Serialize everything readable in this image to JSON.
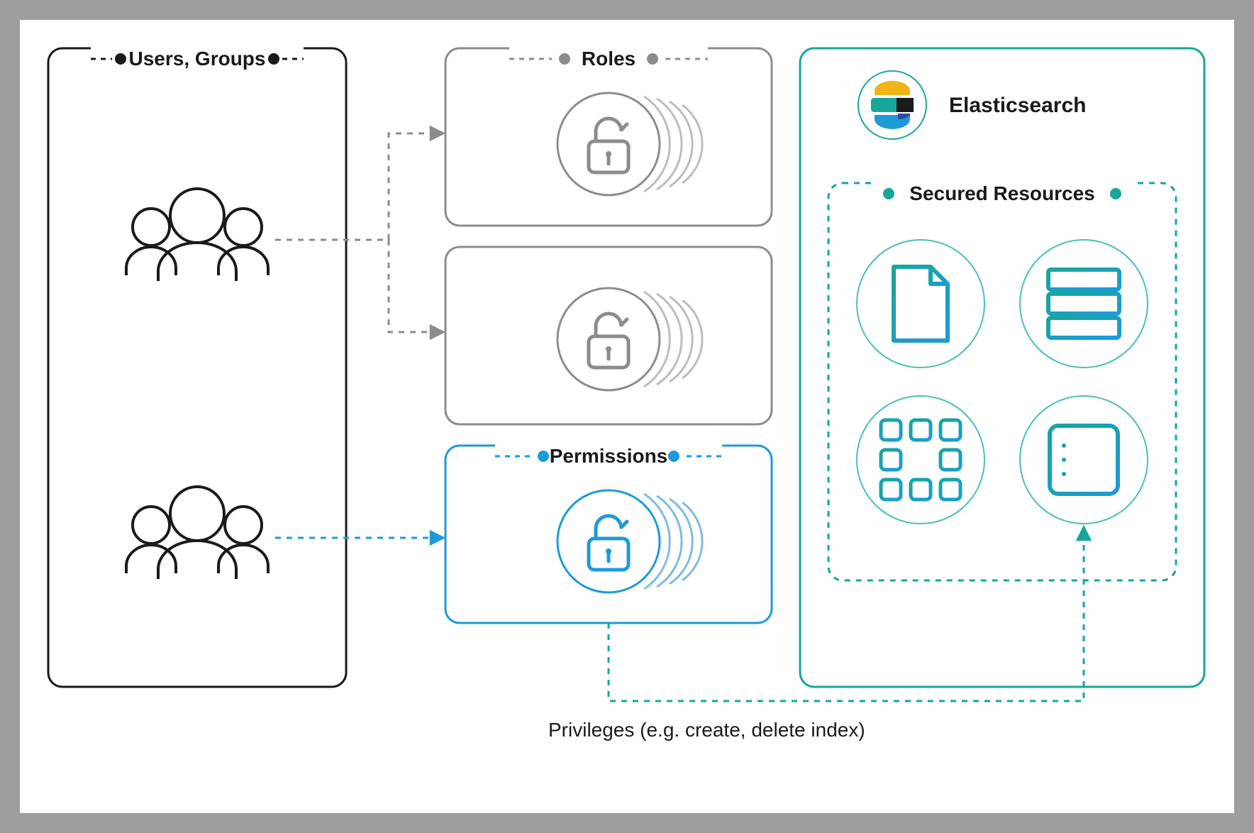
{
  "labels": {
    "users_groups": "Users, Groups",
    "roles": "Roles",
    "permissions": "Permissions",
    "elasticsearch": "Elasticsearch",
    "secured_resources": "Secured Resources",
    "privileges": "Privileges (e.g. create, delete index)"
  },
  "colors": {
    "black": "#1a1a1a",
    "gray": "#8c8c8c",
    "grayLight": "#bdbdbd",
    "blue": "#1c9bd8",
    "bluePale": "#7fbce0",
    "teal": "#17a69b",
    "tealLight": "#4bc0b8",
    "navy": "#2f4b9e",
    "yellow": "#efb514",
    "white": "#ffffff",
    "frame": "#9e9e9e"
  }
}
